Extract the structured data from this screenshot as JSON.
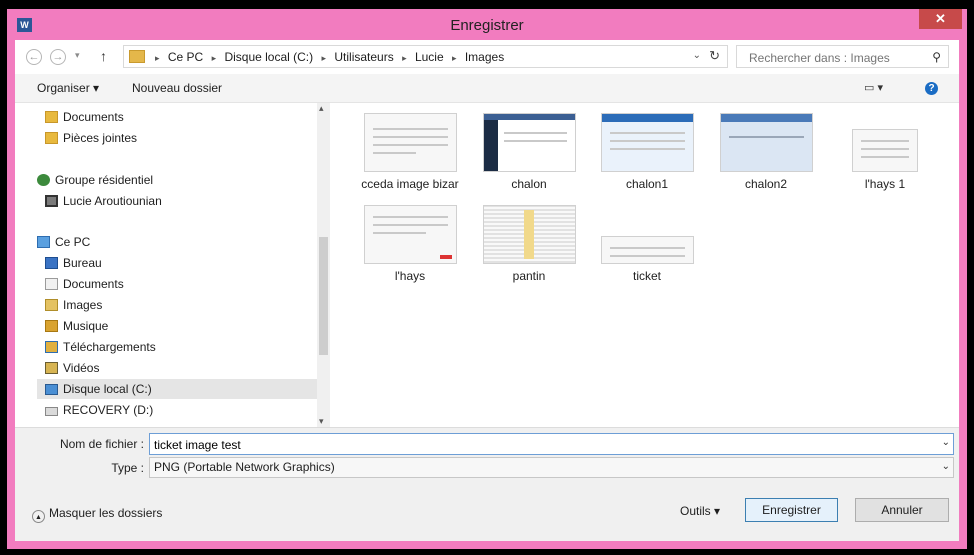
{
  "window": {
    "title": "Enregistrer",
    "close": "✕",
    "app_icon": "W"
  },
  "nav": {
    "back": "←",
    "forward": "→",
    "recent": "▾",
    "up": "↑"
  },
  "address": {
    "crumbs": [
      "Ce PC",
      "Disque local (C:)",
      "Utilisateurs",
      "Lucie",
      "Images"
    ],
    "separator": "▸",
    "dropdown": "⌄",
    "refresh": "↻"
  },
  "search": {
    "placeholder": "Rechercher dans : Images",
    "icon": "⚲"
  },
  "toolbar": {
    "organize": "Organiser ▾",
    "new_folder": "Nouveau dossier",
    "view": "▭ ▾",
    "help": "?"
  },
  "sidebar": {
    "scroll_up": "▴",
    "scroll_down": "▾",
    "items": [
      {
        "label": "Documents",
        "icon": "folder-icon",
        "cls": "ic-folder"
      },
      {
        "label": "Pièces jointes",
        "icon": "folder-icon",
        "cls": "ic-folder"
      },
      {
        "label": "Groupe résidentiel",
        "icon": "homegroup-icon",
        "cls": "ic-home"
      },
      {
        "label": "Lucie Aroutiounian",
        "icon": "user-icon",
        "cls": "ic-user"
      },
      {
        "label": "Ce PC",
        "icon": "computer-icon",
        "cls": "ic-pc"
      },
      {
        "label": "Bureau",
        "icon": "desktop-icon",
        "cls": "ic-desktop"
      },
      {
        "label": "Documents",
        "icon": "documents-icon",
        "cls": "ic-docs"
      },
      {
        "label": "Images",
        "icon": "images-icon",
        "cls": "ic-images"
      },
      {
        "label": "Musique",
        "icon": "music-icon",
        "cls": "ic-music"
      },
      {
        "label": "Téléchargements",
        "icon": "downloads-icon",
        "cls": "ic-download"
      },
      {
        "label": "Vidéos",
        "icon": "videos-icon",
        "cls": "ic-video"
      },
      {
        "label": "Disque local (C:)",
        "icon": "drive-icon",
        "cls": "ic-drive"
      },
      {
        "label": "RECOVERY (D:)",
        "icon": "disk-icon",
        "cls": "ic-disk"
      }
    ]
  },
  "files": [
    {
      "name": "cceda image bizar",
      "thumb": "light"
    },
    {
      "name": "chalon",
      "thumb": "dark"
    },
    {
      "name": "chalon1",
      "thumb": "blue"
    },
    {
      "name": "chalon2",
      "thumb": "blue2"
    },
    {
      "name": "l'hays 1",
      "thumb": "light"
    },
    {
      "name": "l'hays",
      "thumb": "light"
    },
    {
      "name": "pantin",
      "thumb": "grid"
    },
    {
      "name": "ticket",
      "thumb": "light"
    }
  ],
  "footer": {
    "filename_label": "Nom de fichier :",
    "filename_value": "ticket image test",
    "type_label": "Type :",
    "type_value": "PNG (Portable Network Graphics)",
    "dropdown": "⌄",
    "hide_folders": "Masquer les dossiers",
    "hide_icon": "▲",
    "tools": "Outils ▾",
    "save": "Enregistrer",
    "cancel": "Annuler"
  }
}
